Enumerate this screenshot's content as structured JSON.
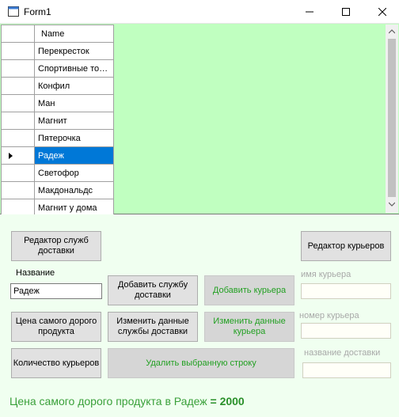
{
  "window": {
    "title": "Form1"
  },
  "grid": {
    "column_header": "Name",
    "rows": [
      "Перекресток",
      "Спортивные тов...",
      "Конфил",
      "Ман",
      "Магнит",
      "Пятерочка",
      "Радеж",
      "Светофор",
      "Макдональдс",
      "Магнит у дома"
    ],
    "selected_index": 6
  },
  "buttons": {
    "delivery_editor": "Редактор служб доставки",
    "couriers_editor": "Редактор курьеров",
    "add_delivery": "Добавить службу доставки",
    "add_courier": "Добавить курьера",
    "max_price": "Цена самого дорого продукта",
    "edit_delivery": "Изменить данные службы доставки",
    "edit_courier": "Изменить данные курьера",
    "courier_count": "Количество курьеров",
    "delete_row": "Удалить выбранную строку"
  },
  "labels": {
    "name": "Название",
    "courier_name": "имя курьера",
    "courier_number": "номер курьера",
    "delivery_name": "название доставки"
  },
  "inputs": {
    "name_value": "Радеж",
    "courier_name_value": "",
    "courier_number_value": "",
    "delivery_name_value": ""
  },
  "result": {
    "text": "Цена самого дорого продукта в Радеж",
    "value": "= 2000"
  }
}
